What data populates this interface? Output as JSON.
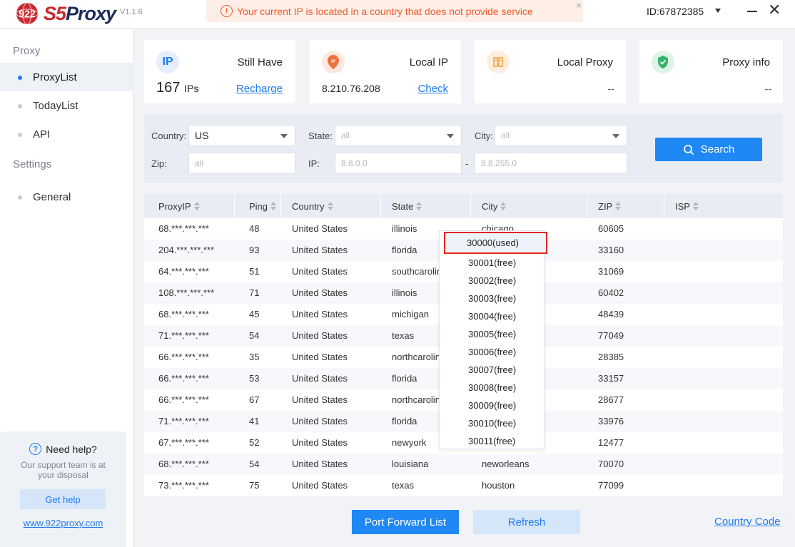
{
  "header": {
    "logo_number": "922",
    "logo_s5": "S5",
    "logo_proxy": "Proxy",
    "version": "V1.1.6",
    "alert_icon": "warning-icon",
    "alert_text": "Your current IP is located in a country that does not provide service",
    "alert_close": "×",
    "user_id": "ID:67872385"
  },
  "sidebar": {
    "group_proxy": "Proxy",
    "items_proxy": [
      "ProxyList",
      "TodayList",
      "API"
    ],
    "group_settings": "Settings",
    "items_settings": [
      "General"
    ],
    "active": "ProxyList"
  },
  "help": {
    "title": "Need help?",
    "desc": "Our support team is at your disposal",
    "button": "Get help",
    "link": "www.922proxy.com"
  },
  "cards": {
    "ip": {
      "icon_text": "IP",
      "label": "Still Have",
      "count": "167",
      "unit": "IPs",
      "link": "Recharge"
    },
    "local_ip": {
      "icon_text": "IP",
      "label": "Local IP",
      "value": "8.210.76.208",
      "link": "Check"
    },
    "local_proxy": {
      "label": "Local Proxy",
      "value": "--"
    },
    "proxy_info": {
      "label": "Proxy info",
      "value": "--"
    }
  },
  "filters": {
    "country_label": "Country:",
    "country_value": "US",
    "state_label": "State:",
    "state_value": "all",
    "city_label": "City:",
    "city_value": "all",
    "zip_label": "Zip:",
    "zip_placeholder": "all",
    "ip_label": "IP:",
    "ip_from_placeholder": "8.8.0.0",
    "ip_sep": "-",
    "ip_to_placeholder": "8.8.255.0",
    "search_label": "Search"
  },
  "table": {
    "columns": [
      "ProxyIP",
      "Ping",
      "Country",
      "State",
      "City",
      "ZIP",
      "ISP"
    ],
    "rows": [
      [
        "68.***.***.***",
        "48",
        "United States",
        "illinois",
        "chicago",
        "60605",
        ""
      ],
      [
        "204.***.***.***",
        "93",
        "United States",
        "florida",
        "",
        "33160",
        ""
      ],
      [
        "64.***.***.***",
        "51",
        "United States",
        "southcarolina",
        "",
        "31069",
        ""
      ],
      [
        "108.***.***.***",
        "71",
        "United States",
        "illinois",
        "",
        "60402",
        ""
      ],
      [
        "68.***.***.***",
        "45",
        "United States",
        "michigan",
        "",
        "48439",
        ""
      ],
      [
        "71.***.***.***",
        "54",
        "United States",
        "texas",
        "",
        "77049",
        ""
      ],
      [
        "66.***.***.***",
        "35",
        "United States",
        "northcarolina",
        "",
        "28385",
        ""
      ],
      [
        "66.***.***.***",
        "53",
        "United States",
        "florida",
        "",
        "33157",
        ""
      ],
      [
        "66.***.***.***",
        "67",
        "United States",
        "northcarolina",
        "",
        "28677",
        ""
      ],
      [
        "71.***.***.***",
        "41",
        "United States",
        "florida",
        "",
        "33976",
        ""
      ],
      [
        "67.***.***.***",
        "52",
        "United States",
        "newyork",
        "",
        "12477",
        ""
      ],
      [
        "68.***.***.***",
        "54",
        "United States",
        "louisiana",
        "neworleans",
        "70070",
        ""
      ],
      [
        "73.***.***.***",
        "75",
        "United States",
        "texas",
        "houston",
        "77099",
        ""
      ]
    ]
  },
  "port_dropdown": {
    "used": "30000(used)",
    "free": [
      "30001(free)",
      "30002(free)",
      "30003(free)",
      "30004(free)",
      "30005(free)",
      "30006(free)",
      "30007(free)",
      "30008(free)",
      "30009(free)",
      "30010(free)",
      "30011(free)"
    ]
  },
  "footer": {
    "port_forward": "Port Forward List",
    "refresh": "Refresh",
    "country_code": "Country Code"
  },
  "colors": {
    "accent": "#1e88f5",
    "alert_bg": "#fdefe8",
    "alert_text": "#f05b2d",
    "highlight_border": "#e0251b"
  }
}
